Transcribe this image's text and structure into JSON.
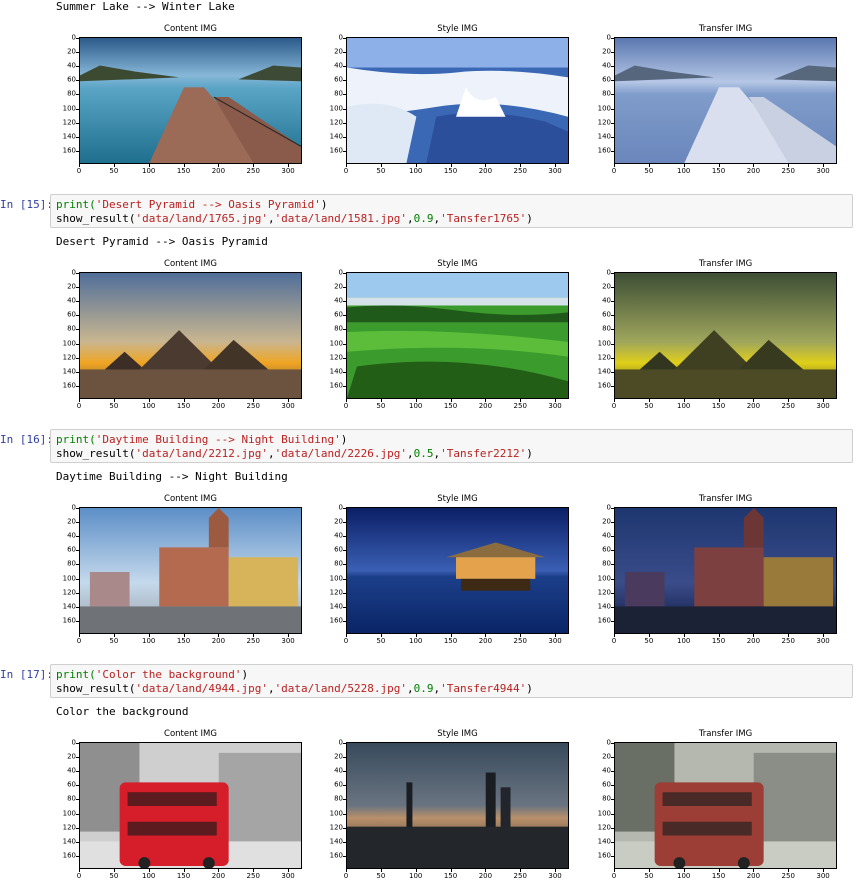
{
  "cells": [
    {
      "output_text": "Summer Lake --> Winter Lake",
      "plots": [
        {
          "title": "Content IMG",
          "scene": "lake-pier"
        },
        {
          "title": "Style IMG",
          "scene": "winter-waterfall"
        },
        {
          "title": "Transfer IMG",
          "scene": "lake-pier-winter"
        }
      ]
    },
    {
      "prompt": "In [15]:",
      "code_line1": [
        "print(",
        "'Desert Pyramid --> Oasis Pyramid'",
        ")"
      ],
      "code_line2": [
        "show_result(",
        "'data/land/1765.jpg'",
        ",",
        "'data/land/1581.jpg'",
        ",",
        "0.9",
        ",",
        "'Tansfer1765'",
        ")"
      ],
      "output_text": "Desert Pyramid --> Oasis Pyramid",
      "plots": [
        {
          "title": "Content IMG",
          "scene": "desert-pyramids"
        },
        {
          "title": "Style IMG",
          "scene": "green-oasis"
        },
        {
          "title": "Transfer IMG",
          "scene": "pyramids-oasis"
        }
      ]
    },
    {
      "prompt": "In [16]:",
      "code_line1": [
        "print(",
        "'Daytime Building --> Night Building'",
        ")"
      ],
      "code_line2": [
        "show_result(",
        "'data/land/2212.jpg'",
        ",",
        "'data/land/2226.jpg'",
        ",",
        "0.5",
        ",",
        "'Tansfer2212'",
        ")"
      ],
      "output_text": "Daytime Building --> Night Building",
      "plots": [
        {
          "title": "Content IMG",
          "scene": "day-buildings"
        },
        {
          "title": "Style IMG",
          "scene": "night-hut"
        },
        {
          "title": "Transfer IMG",
          "scene": "night-buildings"
        }
      ]
    },
    {
      "prompt": "In [17]:",
      "code_line1": [
        "print(",
        "'Color the background'",
        ")"
      ],
      "code_line2": [
        "show_result(",
        "'data/land/4944.jpg'",
        ",",
        "'data/land/5228.jpg'",
        ",",
        "0.9",
        ",",
        "'Tansfer4944'",
        ")"
      ],
      "output_text": "Color the background",
      "plots": [
        {
          "title": "Content IMG",
          "scene": "red-bus-bw"
        },
        {
          "title": "Style IMG",
          "scene": "city-night"
        },
        {
          "title": "Transfer IMG",
          "scene": "bus-tinted"
        }
      ]
    }
  ],
  "axes": {
    "y_ticks": [
      "0",
      "20",
      "40",
      "60",
      "80",
      "100",
      "120",
      "140",
      "160"
    ],
    "x_ticks": [
      "0",
      "50",
      "100",
      "150",
      "200",
      "250",
      "300"
    ],
    "x_range": [
      0,
      320
    ],
    "y_range": [
      0,
      180
    ]
  }
}
